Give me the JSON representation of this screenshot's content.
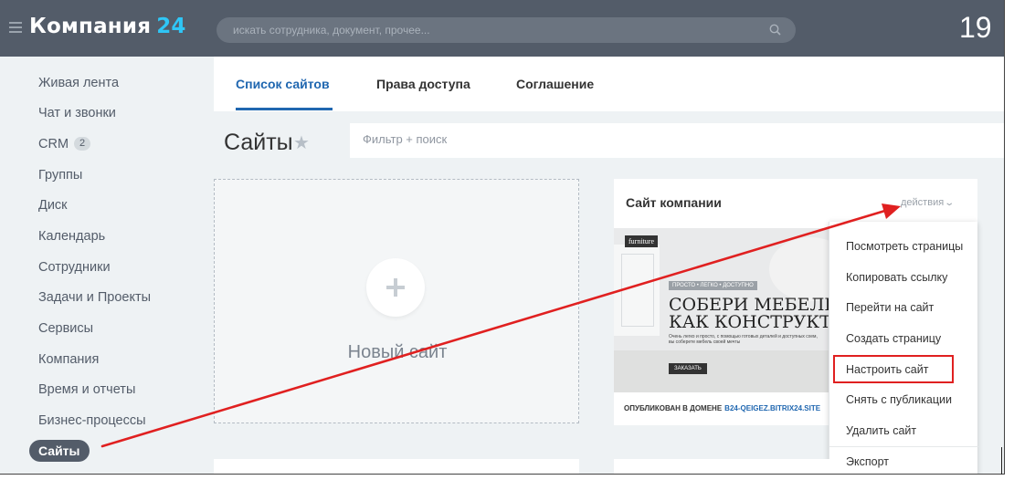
{
  "header": {
    "logo_name": "Компания",
    "logo_num": "24",
    "search_placeholder": "искать сотрудника, документ, прочее...",
    "clock": "19"
  },
  "sidebar": {
    "items": [
      {
        "label": "Живая лента"
      },
      {
        "label": "Чат и звонки"
      },
      {
        "label": "CRM",
        "badge": "2"
      },
      {
        "label": "Группы"
      },
      {
        "label": "Диск"
      },
      {
        "label": "Календарь"
      },
      {
        "label": "Сотрудники"
      },
      {
        "label": "Задачи и Проекты"
      },
      {
        "label": "Сервисы"
      },
      {
        "label": "Компания"
      },
      {
        "label": "Время и отчеты"
      },
      {
        "label": "Бизнес-процессы"
      },
      {
        "label": "Сайты",
        "active": true
      }
    ]
  },
  "tabs": [
    {
      "label": "Список сайтов",
      "active": true
    },
    {
      "label": "Права доступа"
    },
    {
      "label": "Соглашение"
    }
  ],
  "page": {
    "title": "Сайты",
    "filter_placeholder": "Фильтр + поиск",
    "new_site_label": "Новый сайт"
  },
  "site_card": {
    "title": "Сайт компании",
    "actions_label": "действия",
    "preview": {
      "brand": "furniture",
      "tag": "ПРОСТО • ЛЕГКО • ДОСТУПНО",
      "headline_1": "СОБЕРИ МЕБЕЛЬ",
      "headline_2": "КАК КОНСТРУКТОР",
      "sub": "Очень легко и просто, с помощью готовых деталей и доступных схем, вы соберете мебель своей мечты",
      "button": "ЗАКАЗАТЬ"
    },
    "published_label": "ОПУБЛИКОВАН В ДОМЕНЕ",
    "published_domain": "B24-QEIGEZ.BITRIX24.SITE"
  },
  "dropdown": {
    "items": [
      {
        "label": "Посмотреть страницы"
      },
      {
        "label": "Копировать ссылку"
      },
      {
        "label": "Перейти на сайт"
      },
      {
        "label": "Создать страницу"
      },
      {
        "label": "Настроить сайт",
        "highlighted": true
      },
      {
        "label": "Снять с публикации"
      },
      {
        "label": "Удалить сайт"
      },
      {
        "label": "Экспорт"
      }
    ]
  },
  "colors": {
    "header_bg": "#535c69",
    "accent": "#2fc6f6",
    "link": "#2067b0",
    "annotation": "#e02020"
  }
}
